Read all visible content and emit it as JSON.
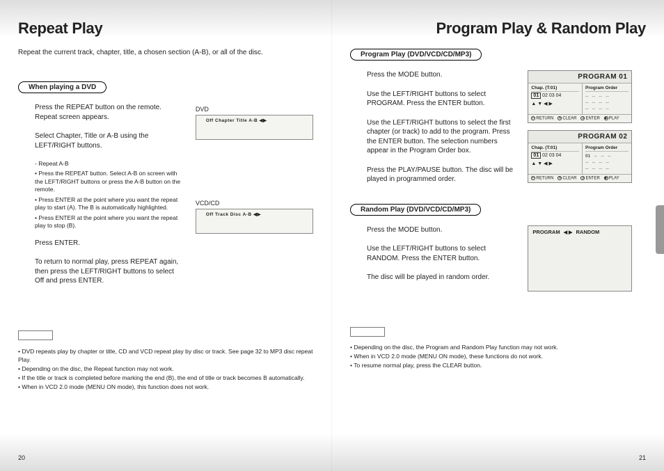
{
  "left": {
    "title": "Repeat Play",
    "intro": "Repeat the current track, chapter, title, a chosen section (A-B), or all of the disc.",
    "pill": "When playing a DVD",
    "steps": {
      "s1": "Press the REPEAT button on the remote. Repeat screen appears.",
      "s2": "Select Chapter, Title or A-B using the LEFT/RIGHT buttons.",
      "sub_head": "- Repeat A-B",
      "sub1": "Press the REPEAT button. Select A-B on screen with the LEFT/RIGHT buttons or press the A-B button on the remote.",
      "sub2": "Press ENTER at the point where you want the repeat play to start (A). The B is automatically highlighted.",
      "sub3": "Press ENTER at the point where you want the repeat play to stop (B).",
      "s3": "Press ENTER.",
      "s4": "To return to normal play, press REPEAT again, then press the LEFT/RIGHT buttons to select Off and press ENTER."
    },
    "fig": {
      "dvd_label": "DVD",
      "dvd_bar": "Off   Chapter   Title   A-B  ◀▶",
      "vcd_label": "VCD/CD",
      "vcd_bar": "Off   Track   Disc   A-B  ◀▶"
    },
    "notes": {
      "n1": "DVD repeats play by chapter or title, CD and VCD repeat play by disc or track. See page 32 to MP3 disc repeat Play.",
      "n2": "Depending on the disc, the Repeat function may not work.",
      "n3": "If the title or track is completed before marking the end (B), the end of title or track becomes B automatically.",
      "n4": "When in VCD 2.0 mode (MENU ON mode), this function does not work."
    },
    "pagenum": "20"
  },
  "right": {
    "title": "Program Play & Random Play",
    "section1": {
      "pill": "Program Play (DVD/VCD/CD/MP3)",
      "s1": "Press the MODE button.",
      "s2": "Use the LEFT/RIGHT buttons to select PROGRAM. Press the ENTER button.",
      "s3": "Use the LEFT/RIGHT buttons to select the first chapter (or track) to add to the program. Press the ENTER button. The selection numbers appear in the Program Order box.",
      "s4": "Press the PLAY/PAUSE button. The disc will be played in programmed order."
    },
    "section2": {
      "pill": "Random Play (DVD/VCD/CD/MP3)",
      "s1": "Press the MODE button.",
      "s2": "Use the LEFT/RIGHT buttons to select RANDOM. Press the ENTER button.",
      "s3": "The disc will be played in random order."
    },
    "panel1": {
      "title": "PROGRAM  01",
      "chap_label": "Chap. (T:01)",
      "order_label": "Program Order",
      "chaps": "01  02  03  04",
      "hl": "01",
      "nav": "▲ ▼ ◀ ▶",
      "foot_return": "RETURN",
      "foot_clear": "CLEAR",
      "foot_enter": "ENTER",
      "foot_play": "PLAY"
    },
    "panel2": {
      "title": "PROGRAM  02",
      "chap_label": "Chap. (T:01)",
      "order_label": "Program Order",
      "chaps": "01  02  03  04",
      "hl": "01",
      "order_first": "01",
      "nav": "▲ ▼ ◀ ▶"
    },
    "random_bar": {
      "prog": "PROGRAM",
      "rand": "RANDOM",
      "arrows": "◀ ▶"
    },
    "notes": {
      "n1": "Depending on the disc, the Program and Random Play function may not work.",
      "n2": "When in VCD 2.0 mode (MENU ON mode), these functions do not work.",
      "n3": "To resume normal play, press the CLEAR button."
    },
    "pagenum": "21"
  }
}
